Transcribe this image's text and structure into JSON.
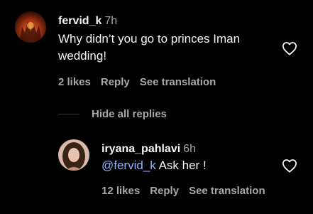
{
  "comment": {
    "username": "fervid_k",
    "time": "7h",
    "text_line1": "Why didn’t you go to princes Iman",
    "text_line2": "wedding!",
    "likes": "2 likes",
    "reply": "Reply",
    "see_translation": "See translation"
  },
  "replies_toggle": {
    "label": "Hide all replies"
  },
  "reply_comment": {
    "username": "iryana_pahlavi",
    "time": "6h",
    "mention": "@fervid_k",
    "text": " Ask her !",
    "likes": "12 likes",
    "reply": "Reply",
    "see_translation": "See translation"
  },
  "colors": {
    "background": "#000000",
    "text": "#f5f5f5",
    "muted": "#a8a8a8",
    "mention": "#8fb4ff"
  },
  "icons": {
    "like": "heart-outline-icon",
    "avatar1": "user-avatar",
    "avatar2": "user-avatar"
  }
}
